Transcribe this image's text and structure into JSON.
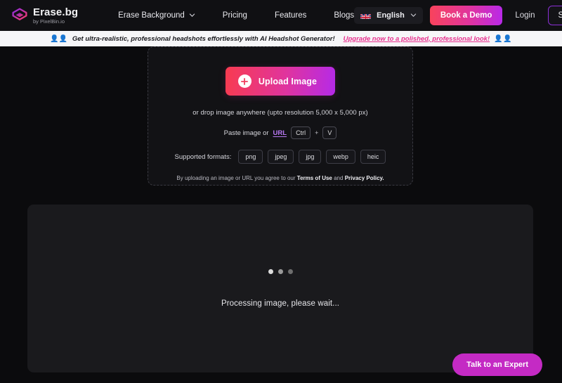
{
  "header": {
    "brand": {
      "title": "Erase.bg",
      "subtitle": "by PixelBin.io",
      "logo_icon": "erasebg-logo-icon"
    },
    "nav": [
      {
        "label": "Erase Background",
        "has_dropdown": true,
        "icon": "chevron-down-icon"
      },
      {
        "label": "Pricing",
        "has_dropdown": false
      },
      {
        "label": "Features",
        "has_dropdown": false
      },
      {
        "label": "Blogs",
        "has_dropdown": false
      }
    ],
    "language": {
      "label": "English",
      "flag_icon": "uk-flag-icon",
      "chevron_icon": "chevron-down-icon"
    },
    "demo_label": "Book a Demo",
    "login_label": "Login",
    "signup_label": "Signup"
  },
  "banner": {
    "left_emoji": "👤👤",
    "right_emoji": "👤👤",
    "text": "Get ultra-realistic, professional headshots effortlessly with AI Headshot Generator!",
    "link_text": "Upgrade now to a polished, professional look!"
  },
  "upload": {
    "button_label": "Upload Image",
    "plus_icon": "plus-circle-icon",
    "drop_hint": "or drop image anywhere (upto resolution 5,000 x 5,000 px)",
    "paste_prefix": "Paste image or",
    "paste_link": "URL",
    "key_ctrl": "Ctrl",
    "key_plus": "+",
    "key_v": "V",
    "formats_label": "Supported formats:",
    "formats": [
      "png",
      "jpeg",
      "jpg",
      "webp",
      "heic"
    ],
    "legal_prefix": "By uploading an image or URL you agree to our",
    "legal_terms": "Terms of Use",
    "legal_and": "and",
    "legal_privacy": "Privacy Policy."
  },
  "processing": {
    "status_text": "Processing image, please wait...",
    "dots": [
      "#dcdcdc",
      "#9a9a9a",
      "#6e6e6e"
    ]
  },
  "fab": {
    "label": "Talk to an Expert"
  },
  "colors": {
    "page_bg": "#0b0b0d",
    "header_bg": "#101013",
    "banner_bg": "#f6f6f8",
    "banner_link": "#e8328f",
    "accent_pink": "#f8435c",
    "accent_purple": "#b929e8",
    "signup_border": "#8b2fd6",
    "url_link": "#b778f2",
    "fab_bg": "#c42ac4",
    "panel_bg": "#1a1a1d"
  }
}
